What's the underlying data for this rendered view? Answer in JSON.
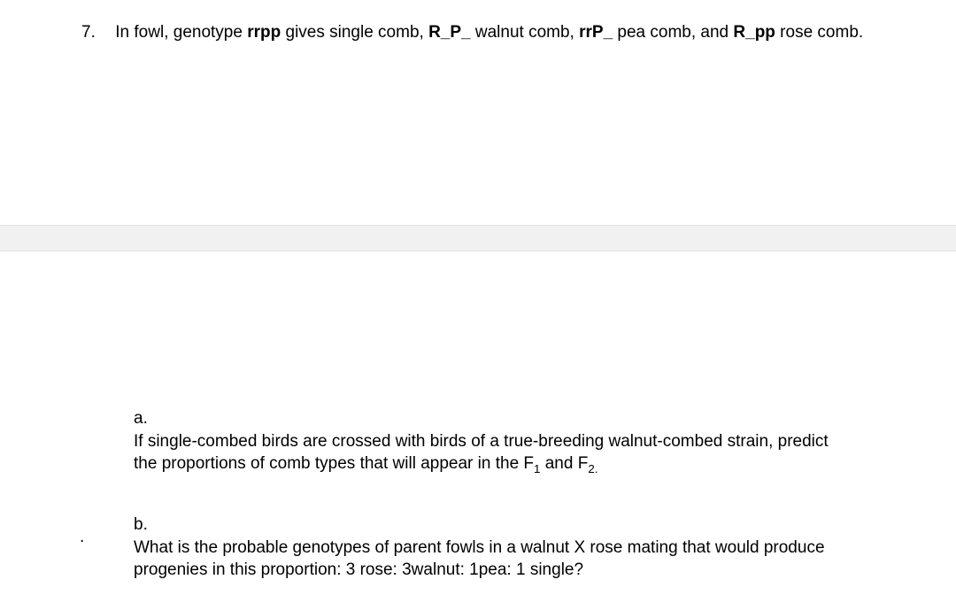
{
  "question": {
    "number": "7.",
    "intro_parts": {
      "p1": "In fowl, genotype ",
      "g1": "rrpp",
      "p2": " gives single comb, ",
      "g2": "R_P_",
      "p3": " walnut comb, ",
      "g3": "rrP_",
      "p4": " pea comb, and ",
      "g4": "R_pp",
      "p5": " rose comb."
    }
  },
  "sub_a": {
    "letter": "a.",
    "parts": {
      "p1": "If single-combed birds are crossed with birds of a true-breeding walnut-combed strain, predict the proportions of comb types that will appear  in the F",
      "s1": "1",
      "p2": " and F",
      "s2": "2.",
      "p3": ""
    }
  },
  "sub_b": {
    "letter": "b.",
    "text": "What is the probable genotypes of parent fowls in a walnut X rose mating that would produce progenies in this proportion:  3 rose: 3walnut: 1pea: 1 single?"
  },
  "dot": "."
}
